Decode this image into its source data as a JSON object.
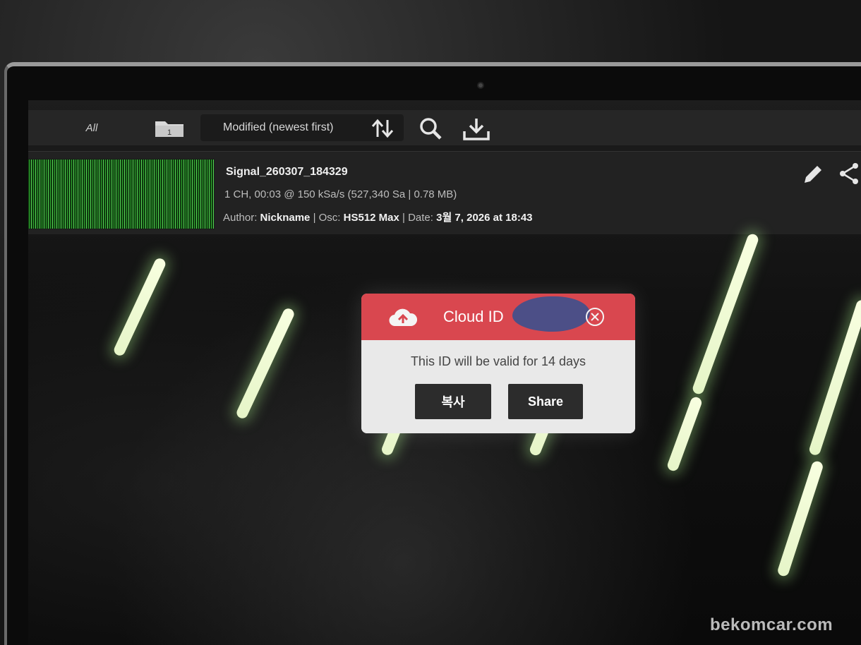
{
  "toolbar": {
    "filter_label": "All",
    "folder_badge": "1",
    "sort_label": "Modified (newest first)"
  },
  "file": {
    "name": "Signal_260307_184329",
    "meta": "1 CH, 00:03 @ 150 kSa/s (527,340 Sa | 0.78 MB)",
    "author_label": "Author: ",
    "author": "Nickname",
    "osc_label": " | Osc: ",
    "osc": "HS512 Max",
    "date_label": " | Date: ",
    "date": "3월 7, 2026 at 18:43"
  },
  "dialog": {
    "title": "Cloud ID",
    "message": "This ID will be valid for 14 days",
    "copy_label": "복사",
    "share_label": "Share",
    "header_color": "#d9474f"
  },
  "watermark": "bekomcar.com"
}
